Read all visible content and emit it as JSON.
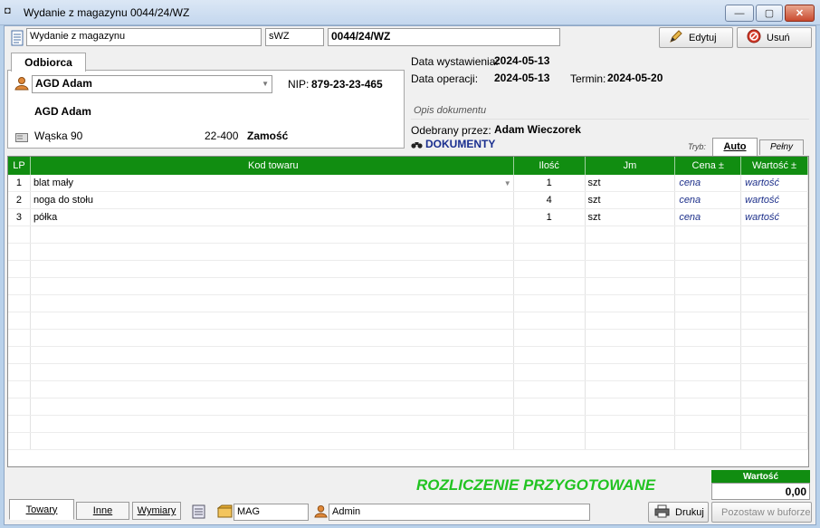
{
  "window": {
    "title": "Wydanie z magazynu 0044/24/WZ",
    "minimize": "—",
    "maximize": "▢",
    "close": "✕"
  },
  "toolbar": {
    "doc_type": "Wydanie z magazynu",
    "series": "sWZ",
    "number": "0044/24/WZ",
    "edit_label": "Edytuj",
    "delete_label": "Usuń"
  },
  "customer": {
    "tab_label": "Odbiorca",
    "name": "AGD Adam",
    "nip_label": "NIP:",
    "nip": "879-23-23-465",
    "full_name": "AGD Adam",
    "street": "Wąska 90",
    "postal": "22-400",
    "city": "Zamość"
  },
  "info": {
    "issue_date_label": "Data wystawienia:",
    "issue_date": "2024-05-13",
    "op_date_label": "Data operacji:",
    "op_date": "2024-05-13",
    "due_label": "Termin:",
    "due": "2024-05-20",
    "desc_placeholder": "Opis dokumentu",
    "received_label": "Odebrany przez:",
    "received_by": "Adam Wieczorek",
    "documents_label": "DOKUMENTY",
    "mode_label": "Tryb:",
    "mode_auto": "Auto",
    "mode_full": "Pełny"
  },
  "grid": {
    "headers": [
      "LP",
      "Kod towaru",
      "Ilość",
      "Jm",
      "Cena ±",
      "Wartość ±"
    ],
    "rows": [
      {
        "lp": "1",
        "name": "blat mały",
        "qty": "1",
        "unit": "szt",
        "price": "cena",
        "value": "wartość"
      },
      {
        "lp": "2",
        "name": "noga do stołu",
        "qty": "4",
        "unit": "szt",
        "price": "cena",
        "value": "wartość"
      },
      {
        "lp": "3",
        "name": "półka",
        "qty": "1",
        "unit": "szt",
        "price": "cena",
        "value": "wartość"
      }
    ]
  },
  "status": {
    "settlement": "ROZLICZENIE PRZYGOTOWANE",
    "value_label": "Wartość",
    "value": "0,00"
  },
  "bottom": {
    "tabs": [
      "Towary",
      "Inne",
      "Wymiary"
    ],
    "warehouse": "MAG",
    "user": "Admin",
    "print_label": "Drukuj",
    "buffer_label": "Pozostaw w buforze"
  },
  "colors": {
    "grid_header": "#118d11",
    "settlement_text": "#22c322",
    "documents_text": "#1a2f8f"
  }
}
